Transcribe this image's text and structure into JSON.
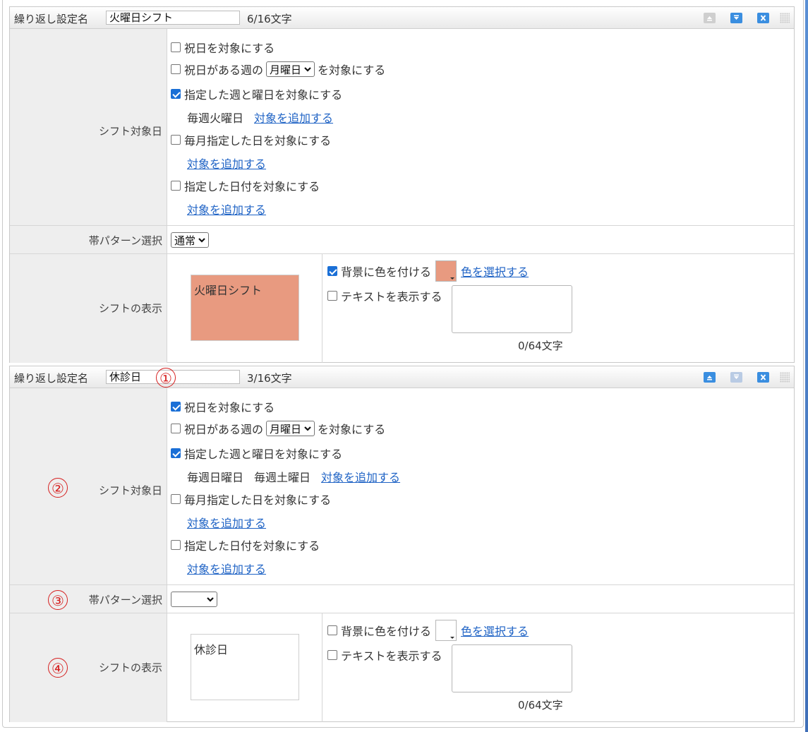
{
  "common": {
    "name_label": "繰り返し設定名",
    "shift_target_label": "シフト対象日",
    "band_label": "帯パターン選択",
    "display_label": "シフトの表示",
    "opt_holiday": "祝日を対象にする",
    "opt_holiday_week_pre": "祝日がある週の",
    "opt_holiday_week_post": "を対象にする",
    "opt_week_day": "指定した週と曜日を対象にする",
    "opt_monthly": "毎月指定した日を対象にする",
    "opt_date": "指定した日付を対象にする",
    "add_target": "対象を追加する",
    "bg_color": "背景に色を付ける",
    "choose_color": "色を選択する",
    "show_text": "テキストを表示する",
    "text_count": "0/64文字"
  },
  "block1": {
    "name_value": "火曜日シフト",
    "name_count": "6/16文字",
    "holiday_checked": false,
    "week_select": "月曜日",
    "week_day_checked": true,
    "week_days": [
      "毎週火曜日"
    ],
    "monthly_checked": false,
    "date_checked": false,
    "band_value": "通常",
    "preview_text": "火曜日シフト",
    "bg_checked": true,
    "bg_color": "#e89a80",
    "text_checked": false
  },
  "block2": {
    "name_value": "休診日",
    "name_count": "3/16文字",
    "holiday_checked": true,
    "week_select": "月曜日",
    "week_day_checked": true,
    "week_days": [
      "毎週日曜日",
      "毎週土曜日"
    ],
    "monthly_checked": false,
    "date_checked": false,
    "band_value": "",
    "preview_text": "休診日",
    "bg_checked": false,
    "bg_color": "#ffffff",
    "text_checked": false
  },
  "annotations": [
    "①",
    "②",
    "③",
    "④"
  ],
  "colors": {
    "link": "#1f63c5",
    "check": "#1a6fd6",
    "header_btn": "#3a8ee0",
    "header_btn_disabled": "#b9cbe4",
    "annotation": "#d62020"
  }
}
